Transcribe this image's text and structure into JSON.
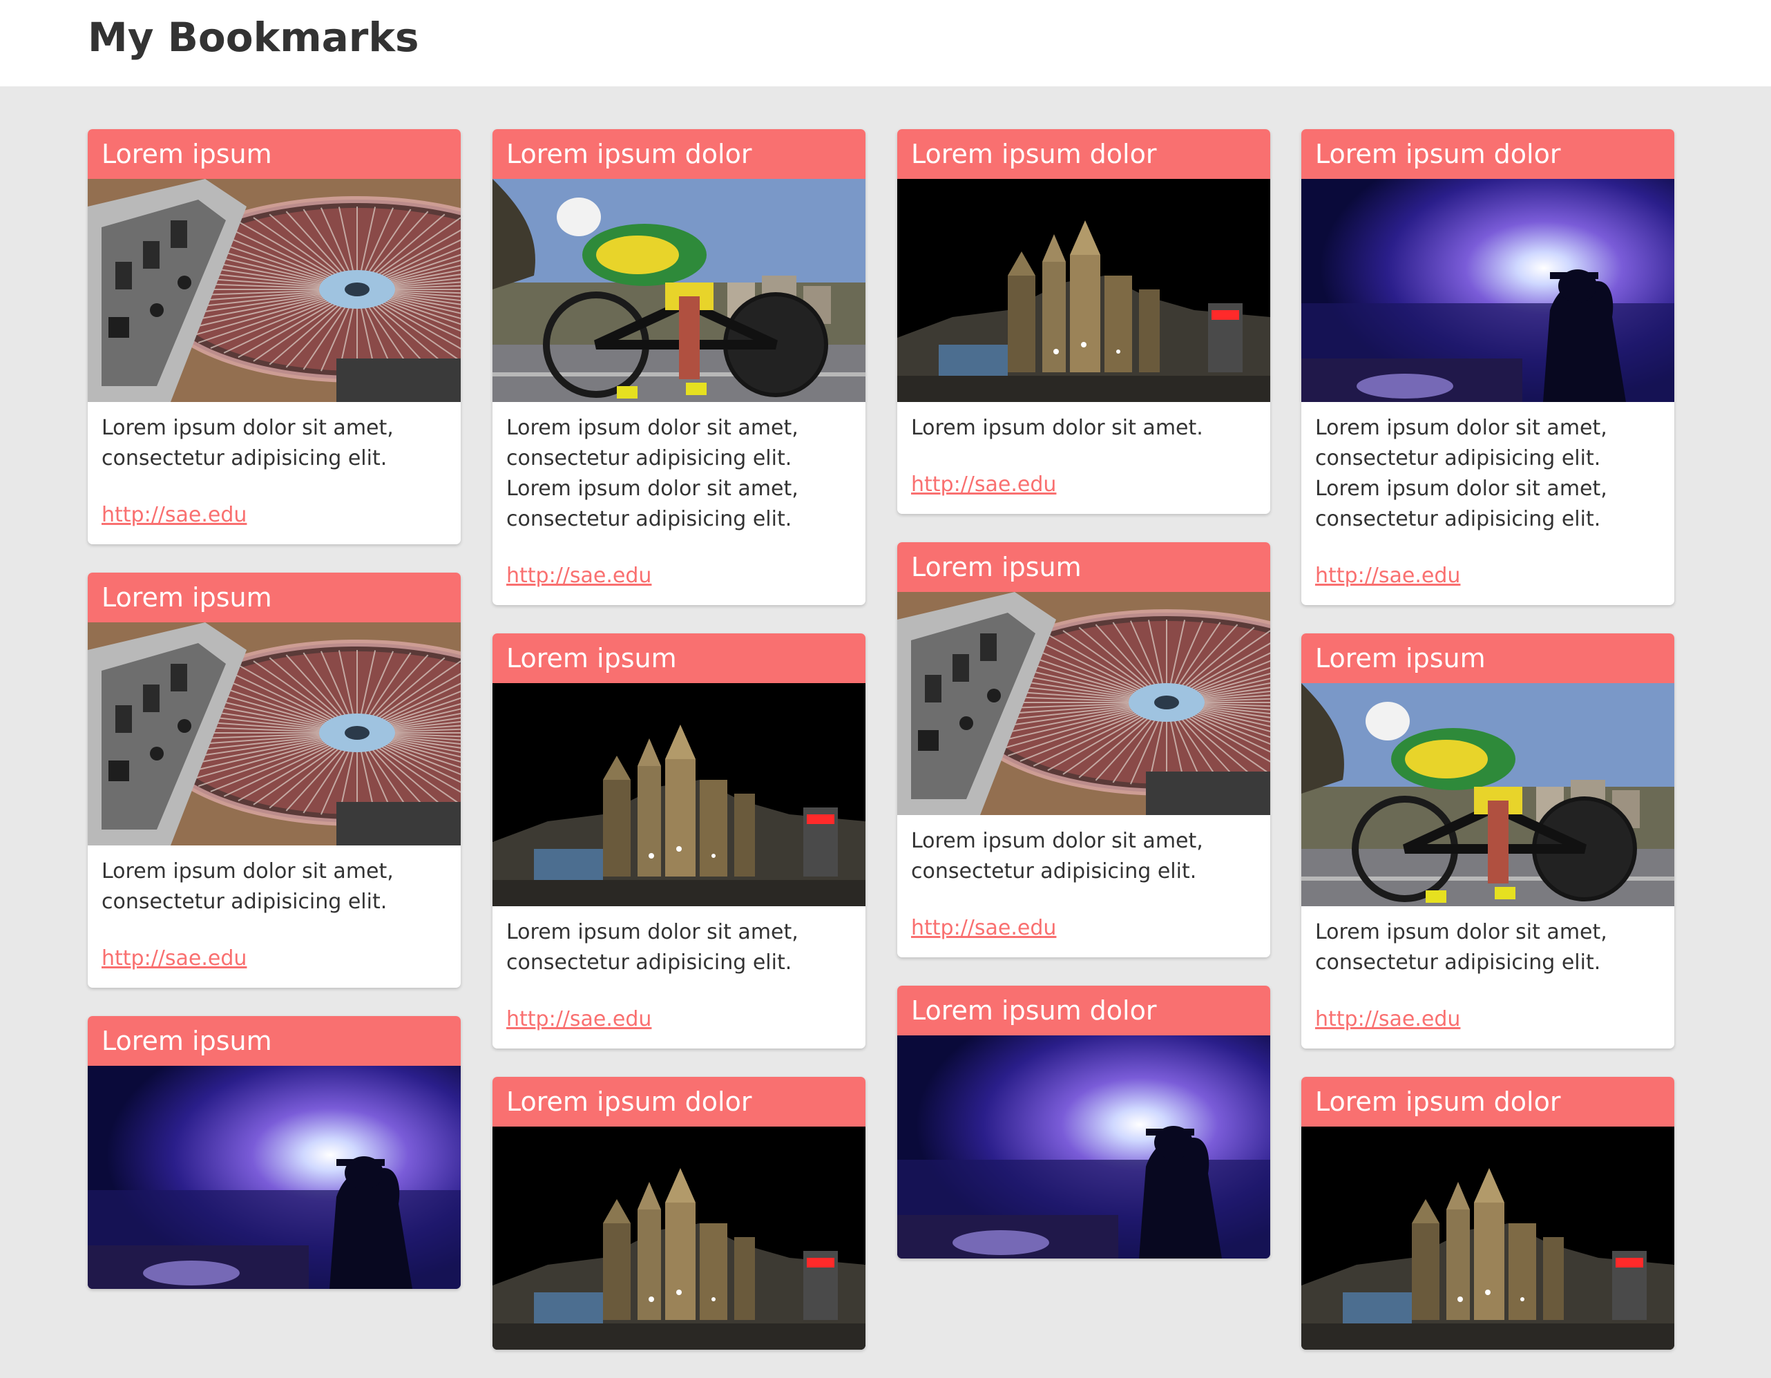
{
  "page": {
    "title": "My Bookmarks"
  },
  "colors": {
    "accent": "#f97070",
    "background": "#e8e8e8",
    "card": "#ffffff",
    "text": "#333333"
  },
  "columns": [
    {
      "cards": [
        {
          "title": "Lorem ipsum",
          "image": "turntable",
          "description": "Lorem ipsum dolor sit amet, consectetur adipisicing elit.",
          "link": "http://sae.edu"
        },
        {
          "title": "Lorem ipsum",
          "image": "turntable",
          "description": "Lorem ipsum dolor sit amet, consectetur adipisicing elit.",
          "link": "http://sae.edu"
        },
        {
          "title": "Lorem ipsum",
          "image": "concert",
          "description": "",
          "link": ""
        }
      ]
    },
    {
      "cards": [
        {
          "title": "Lorem ipsum dolor",
          "image": "cyclist",
          "description": "Lorem ipsum dolor sit amet, consectetur adipisicing elit. Lorem ipsum dolor sit amet, consectetur adipisicing elit.",
          "link": "http://sae.edu"
        },
        {
          "title": "Lorem ipsum",
          "image": "city-night",
          "description": "Lorem ipsum dolor sit amet, consectetur adipisicing elit.",
          "link": "http://sae.edu"
        },
        {
          "title": "Lorem ipsum dolor",
          "image": "city-night",
          "description": "",
          "link": ""
        }
      ]
    },
    {
      "cards": [
        {
          "title": "Lorem ipsum dolor",
          "image": "city-night",
          "description": "Lorem ipsum dolor sit amet.",
          "link": "http://sae.edu"
        },
        {
          "title": "Lorem ipsum",
          "image": "turntable",
          "description": "Lorem ipsum dolor sit amet, consectetur adipisicing elit.",
          "link": "http://sae.edu"
        },
        {
          "title": "Lorem ipsum dolor",
          "image": "concert",
          "description": "",
          "link": ""
        }
      ]
    },
    {
      "cards": [
        {
          "title": "Lorem ipsum dolor",
          "image": "concert",
          "description": "Lorem ipsum dolor sit amet, consectetur adipisicing elit. Lorem ipsum dolor sit amet, consectetur adipisicing elit.",
          "link": "http://sae.edu"
        },
        {
          "title": "Lorem ipsum",
          "image": "cyclist",
          "description": "Lorem ipsum dolor sit amet, consectetur adipisicing elit.",
          "link": "http://sae.edu"
        },
        {
          "title": "Lorem ipsum dolor",
          "image": "city-night",
          "description": "",
          "link": ""
        }
      ]
    }
  ]
}
